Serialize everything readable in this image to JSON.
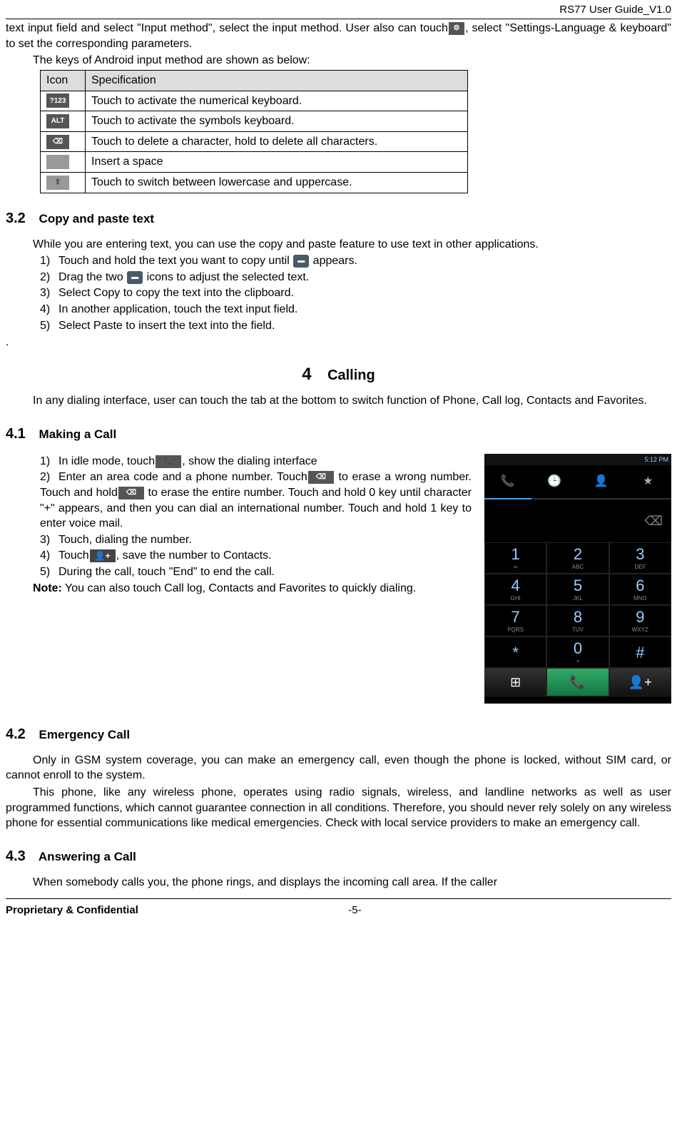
{
  "header": {
    "doc_id": "RS77 User Guide_V1.0"
  },
  "footer": {
    "left": "Proprietary & Confidential",
    "page": "-5-"
  },
  "intro": {
    "p1a": "text input field and select \"Input method\", select the input method. User also can touch",
    "p1b": ", select \"Settings-Language & keyboard\" to set the corresponding parameters.",
    "p2": "The keys of Android input method are shown as below:"
  },
  "icon_table": {
    "h1": "Icon",
    "h2": "Specification",
    "rows": [
      {
        "icon_label": "?123",
        "spec": "Touch to activate the numerical keyboard."
      },
      {
        "icon_label": "ALT",
        "spec": "Touch to activate the symbols keyboard."
      },
      {
        "icon_label": "⌫",
        "spec": "Touch to delete a character, hold to delete all characters."
      },
      {
        "icon_label": " ",
        "spec": "Insert a space"
      },
      {
        "icon_label": "⇧",
        "spec": "Touch to switch between lowercase and uppercase."
      }
    ]
  },
  "s32": {
    "num": "3.2",
    "title": "Copy and paste text",
    "intro": "While you are entering text, you can use the copy and paste feature to use text in other applications.",
    "items": {
      "i1a": "Touch and hold the text you want to copy until ",
      "i1b": " appears.",
      "i2a": "Drag the two ",
      "i2b": " icons to adjust the selected text.",
      "i3": "Select Copy to copy the text into the clipboard.",
      "i4": "In another application, touch the text input field.",
      "i5": "Select Paste to insert the text into the field."
    },
    "dot": "."
  },
  "ch4": {
    "num": "4",
    "title": "Calling",
    "intro": "In any dialing interface, user can touch the tab at the bottom to switch function of Phone, Call log, Contacts and Favorites."
  },
  "s41": {
    "num": "4.1",
    "title": "Making a Call",
    "items": {
      "i1a": "In idle mode, touch",
      "i1b": ", show the dialing interface",
      "i2a": "Enter an area code and a phone number. Touch",
      "i2b": " to erase a wrong number. Touch   and hold",
      "i2c": " to erase the entire number. Touch and hold 0 key until character \"+\" appears, and then you can dial an international number. Touch and hold 1 key to enter voice mail.",
      "i3": "Touch, dialing the number.",
      "i4a": "Touch",
      "i4b": ", save the number to Contacts.",
      "i5": "During the call, touch \"End\" to end the call."
    },
    "note_label": "Note:",
    "note_text": " You can also touch Call log, Contacts and Favorites to quickly dialing."
  },
  "dialer": {
    "time": "5:12 PM",
    "tabs": [
      "📞",
      "🕒",
      "👤",
      "★"
    ],
    "keys": [
      {
        "d": "1",
        "s": "∞"
      },
      {
        "d": "2",
        "s": "ABC"
      },
      {
        "d": "3",
        "s": "DEF"
      },
      {
        "d": "4",
        "s": "GHI"
      },
      {
        "d": "5",
        "s": "JKL"
      },
      {
        "d": "6",
        "s": "MNO"
      },
      {
        "d": "7",
        "s": "PQRS"
      },
      {
        "d": "8",
        "s": "TUV"
      },
      {
        "d": "9",
        "s": "WXYZ"
      },
      {
        "d": "*",
        "s": ""
      },
      {
        "d": "0",
        "s": "+"
      },
      {
        "d": "#",
        "s": ""
      }
    ],
    "bottom": [
      "⊞",
      "📞",
      "👤+"
    ],
    "backspace": "⌫"
  },
  "s42": {
    "num": "4.2",
    "title": "Emergency Call",
    "p1": "Only in GSM system coverage, you can make an emergency call, even though the phone is locked, without SIM card, or cannot enroll to the system.",
    "p2": "This phone, like any wireless phone, operates using radio signals, wireless, and landline networks as well as user programmed functions, which cannot guarantee connection in all conditions. Therefore, you should never rely solely on any wireless phone for essential communications like medical emergencies. Check with local service providers to make an emergency call."
  },
  "s43": {
    "num": "4.3",
    "title": "Answering a Call",
    "p1": "When somebody calls you, the phone rings, and displays the incoming call area. If the caller"
  }
}
